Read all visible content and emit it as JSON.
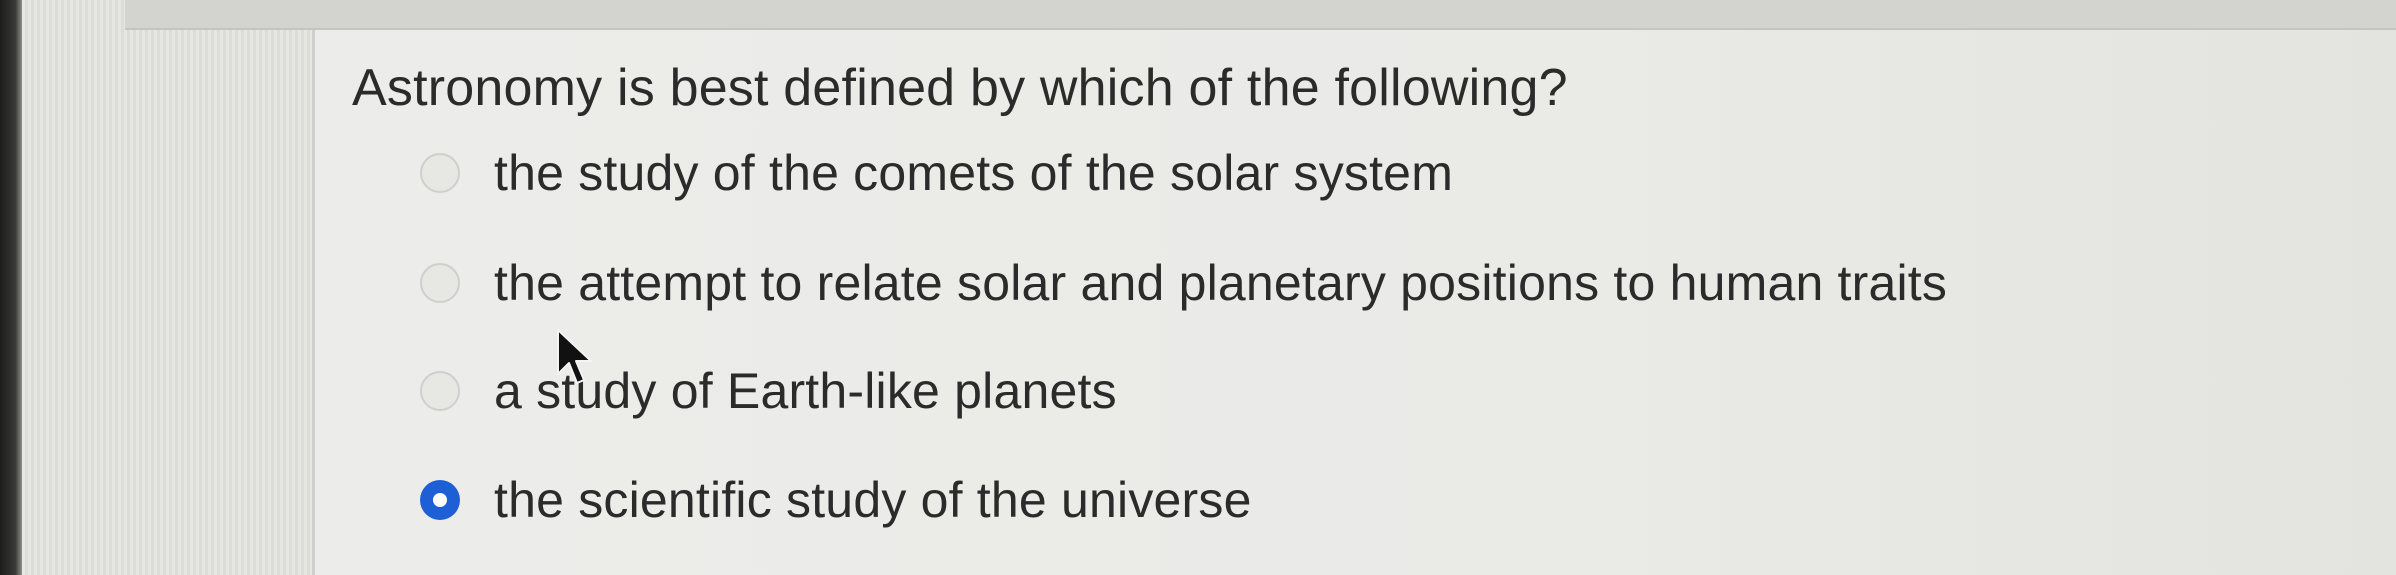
{
  "question": {
    "prompt": "Astronomy is best defined by which of the following?",
    "options": [
      {
        "label": "the study of the comets of the solar system",
        "selected": false
      },
      {
        "label": "the attempt to relate solar and planetary positions to human traits",
        "selected": false
      },
      {
        "label": "a study of Earth-like planets",
        "selected": false
      },
      {
        "label": "the scientific study of the universe",
        "selected": true
      }
    ]
  },
  "colors": {
    "selected_radio": "#1f5fd6",
    "text": "#2b2b2b",
    "background": "#ececea"
  },
  "icons": {
    "cursor": "mouse-pointer-icon"
  }
}
